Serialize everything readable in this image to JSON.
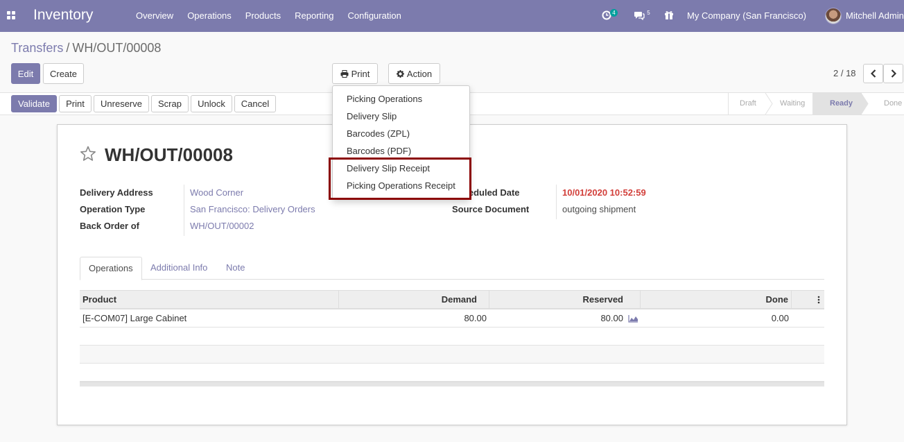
{
  "navbar": {
    "brand": "Inventory",
    "menu": [
      "Overview",
      "Operations",
      "Products",
      "Reporting",
      "Configuration"
    ],
    "activity_count": "4",
    "message_count": "5",
    "company": "My Company (San Francisco)",
    "user": "Mitchell Admin"
  },
  "breadcrumb": {
    "parent": "Transfers",
    "separator": "/",
    "current": "WH/OUT/00008"
  },
  "toolbar": {
    "edit": "Edit",
    "create": "Create",
    "print": "Print",
    "action": "Action"
  },
  "pager": {
    "value": "2 / 18"
  },
  "statusbar": {
    "buttons": [
      "Validate",
      "Print",
      "Unreserve",
      "Scrap",
      "Unlock",
      "Cancel"
    ],
    "stages": [
      "Draft",
      "Waiting",
      "Ready",
      "Done"
    ],
    "active_stage": "Ready"
  },
  "print_menu": {
    "items": [
      "Picking Operations",
      "Delivery Slip",
      "Barcodes (ZPL)",
      "Barcodes (PDF)",
      "Delivery Slip Receipt",
      "Picking Operations Receipt"
    ]
  },
  "form": {
    "title": "WH/OUT/00008",
    "left_fields": [
      {
        "label": "Delivery Address",
        "value": "Wood Corner"
      },
      {
        "label": "Operation Type",
        "value": "San Francisco: Delivery Orders"
      },
      {
        "label": "Back Order of",
        "value": "WH/OUT/00002"
      }
    ],
    "right_fields": [
      {
        "label": "Scheduled Date",
        "value": "10/01/2020 10:52:59"
      },
      {
        "label": "Source Document",
        "value": "outgoing shipment"
      }
    ],
    "tabs": [
      "Operations",
      "Additional Info",
      "Note"
    ],
    "table": {
      "columns": [
        "Product",
        "Demand",
        "Reserved",
        "Done"
      ],
      "rows": [
        {
          "product": "[E-COM07] Large Cabinet",
          "demand": "80.00",
          "reserved": "80.00",
          "done": "0.00"
        }
      ]
    }
  },
  "colors": {
    "brand": "#7c7bad",
    "highlight": "#8b0000",
    "date_red": "#d23f3a"
  }
}
